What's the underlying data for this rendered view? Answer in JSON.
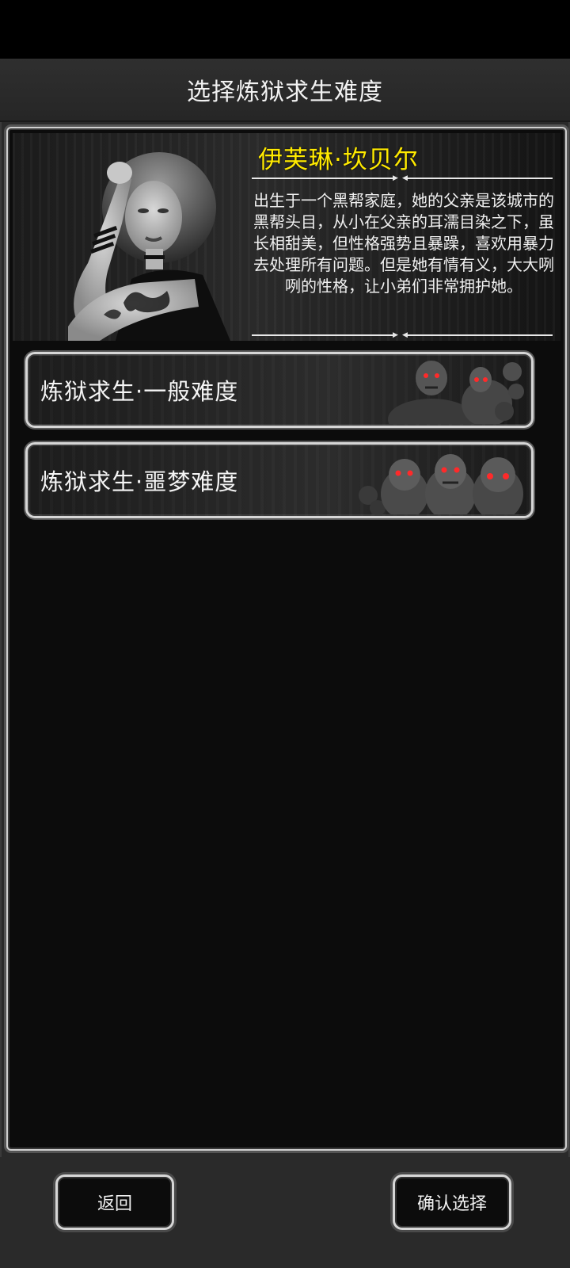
{
  "header": {
    "title": "选择炼狱求生难度"
  },
  "character": {
    "name": "伊芙琳·坎贝尔",
    "description": "出生于一个黑帮家庭，她的父亲是该城市的黑帮头目，从小在父亲的耳濡目染之下，虽长相甜美，但性格强势且暴躁，喜欢用暴力去处理所有问题。但是她有情有义，大大咧咧的性格，让小弟们非常拥护她。"
  },
  "difficulties": [
    {
      "label": "炼狱求生·一般难度"
    },
    {
      "label": "炼狱求生·噩梦难度"
    }
  ],
  "footer": {
    "back_label": "返回",
    "confirm_label": "确认选择"
  },
  "colors": {
    "name_accent": "#ffea00",
    "zombie_eyes": "#ff2a2a",
    "panel_border": "#cfcfcf"
  }
}
